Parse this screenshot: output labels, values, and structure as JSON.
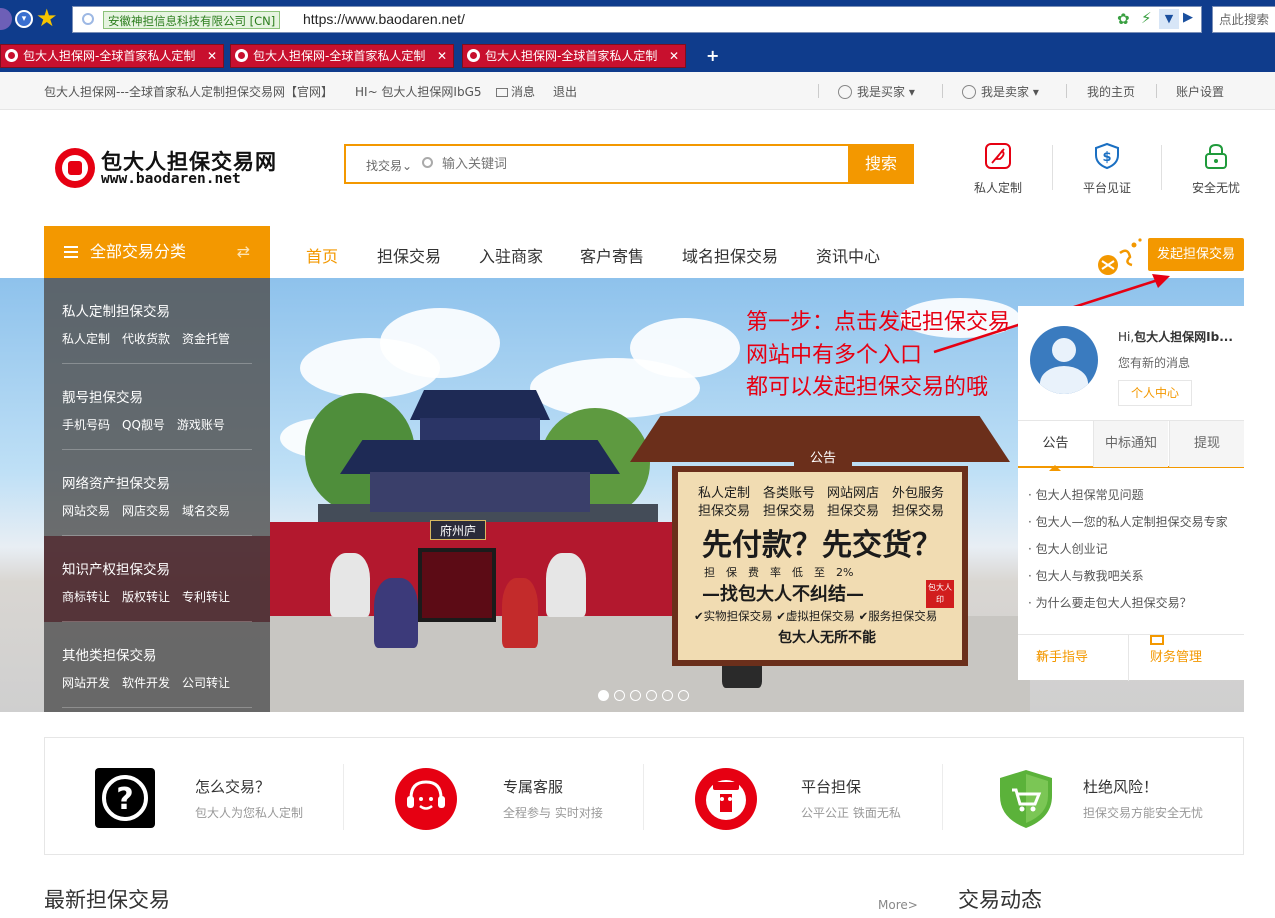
{
  "browser": {
    "security_label": "安徽神担信息科技有限公司 [CN]",
    "url": "https://www.baodaren.net/",
    "search_placeholder": "点此搜索",
    "tabs": [
      {
        "label": "包大人担保网-全球首家私人定制"
      },
      {
        "label": "包大人担保网-全球首家私人定制"
      },
      {
        "label": "包大人担保网-全球首家私人定制"
      }
    ],
    "new_tab": "+"
  },
  "topbar": {
    "site_title": "包大人担保网---全球首家私人定制担保交易网【官网】",
    "greeting": "HI~ 包大人担保网IbG5",
    "messages": "消息",
    "logout": "退出",
    "buyer": "我是买家",
    "seller": "我是卖家",
    "my_home": "我的主页",
    "account": "账户设置"
  },
  "header": {
    "logo_name": "包大人担保交易网",
    "logo_domain": "www.baodaren.net",
    "search_type": "找交易",
    "search_placeholder": "输入关键词",
    "search_button": "搜索",
    "icons": [
      {
        "label": "私人定制",
        "icon": "feather-icon",
        "color": "#e60012"
      },
      {
        "label": "平台见证",
        "icon": "shield-dollar-icon",
        "color": "#1a6fc2"
      },
      {
        "label": "安全无忧",
        "icon": "lock-icon",
        "color": "#1f9a3b"
      }
    ]
  },
  "nav": {
    "category_button": "全部交易分类",
    "items": [
      "首页",
      "担保交易",
      "入驻商家",
      "客户寄售",
      "域名担保交易",
      "资讯中心"
    ],
    "launch_button": "发起担保交易"
  },
  "sidebar": {
    "groups": [
      {
        "title": "私人定制担保交易",
        "subs": [
          "私人定制",
          "代收货款",
          "资金托管"
        ]
      },
      {
        "title": "靓号担保交易",
        "subs": [
          "手机号码",
          "QQ靓号",
          "游戏账号"
        ]
      },
      {
        "title": "网络资产担保交易",
        "subs": [
          "网站交易",
          "网店交易",
          "域名交易"
        ]
      },
      {
        "title": "知识产权担保交易",
        "subs": [
          "商标转让",
          "版权转让",
          "专利转让"
        ]
      },
      {
        "title": "其他类担保交易",
        "subs": [
          "网站开发",
          "软件开发",
          "公司转让"
        ]
      }
    ]
  },
  "banner": {
    "gate_plaque": "府州庐",
    "board_tag": "公告",
    "board_row1": [
      "私人定制",
      "各类账号",
      "网站网店",
      "外包服务"
    ],
    "board_row2": [
      "担保交易",
      "担保交易",
      "担保交易",
      "担保交易"
    ],
    "board_headline": "先付款？先交货？",
    "board_fee": "担　保　费　率　低　至　2%",
    "board_slogan": "—找包大人不纠结—",
    "board_checks": "✔实物担保交易 ✔虚拟担保交易 ✔服务担保交易",
    "board_footer": "包大人无所不能",
    "seal": "包大人印",
    "annotation": [
      "第一步：点击发起担保交易",
      "网站中有多个入口",
      "都可以发起担保交易的哦"
    ],
    "dots_count": 6,
    "active_dot": 0
  },
  "user_card": {
    "hi": "Hi,",
    "username": "包大人担保网Ib...",
    "new_msg": "您有新的消息",
    "center_button": "个人中心",
    "tabs": [
      "公告",
      "中标通知",
      "提现"
    ],
    "news": [
      "· 包大人担保常见问题",
      "· 包大人—您的私人定制担保交易专家",
      "· 包大人创业记",
      "· 包大人与教我吧关系",
      "· 为什么要走包大人担保交易？"
    ],
    "guide": "新手指导",
    "finance": "财务管理"
  },
  "features": [
    {
      "title": "怎么交易？",
      "sub": "包大人为您私人定制",
      "icon": "question-icon"
    },
    {
      "title": "专属客服",
      "sub": "全程参与 实时对接",
      "icon": "headset-icon"
    },
    {
      "title": "平台担保",
      "sub": "公平公正 铁面无私",
      "icon": "judge-icon"
    },
    {
      "title": "杜绝风险！",
      "sub": "担保交易方能安全无忧",
      "icon": "cart-shield-icon"
    }
  ],
  "sections": {
    "latest": "最新担保交易",
    "more": "More>",
    "dynamics": "交易动态"
  },
  "colors": {
    "accent": "#f39800",
    "brand_red": "#e60012",
    "chrome": "#0f3c8c"
  }
}
